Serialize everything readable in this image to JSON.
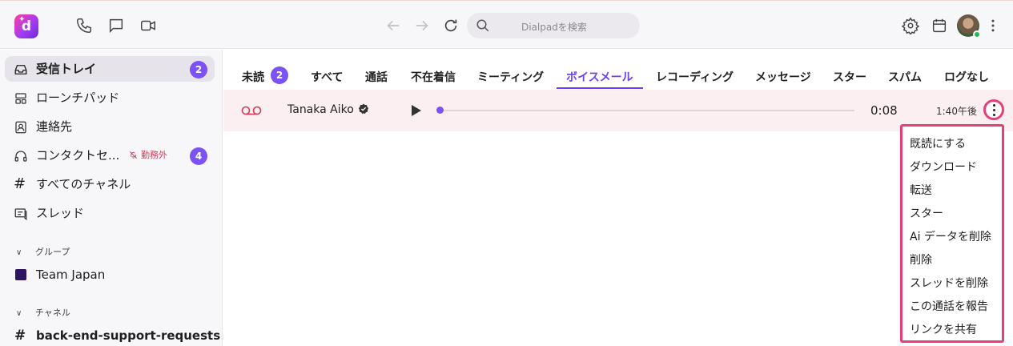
{
  "topbar": {
    "logo_letter": "d",
    "search_placeholder": "Dialpadを検索"
  },
  "sidebar": {
    "items": [
      {
        "label": "受信トレイ",
        "badge": "2",
        "icon": "inbox-icon"
      },
      {
        "label": "ローンチパッド",
        "icon": "launchpad-icon"
      },
      {
        "label": "連絡先",
        "icon": "contacts-icon"
      },
      {
        "label": "コンタクトセ...",
        "status": "勤務外",
        "badge": "4",
        "icon": "headset-icon"
      },
      {
        "label": "すべてのチャネル",
        "icon": "hash-icon"
      },
      {
        "label": "スレッド",
        "icon": "threads-icon"
      }
    ],
    "groups_header": "グループ",
    "groups": [
      {
        "label": "Team Japan",
        "color": "#2d1460"
      }
    ],
    "channels_header": "チャネル",
    "channels": [
      {
        "label": "back-end-support-requests"
      }
    ]
  },
  "tabs": {
    "items": [
      {
        "label": "未読",
        "badge": "2"
      },
      {
        "label": "すべて"
      },
      {
        "label": "通話"
      },
      {
        "label": "不在着信"
      },
      {
        "label": "ミーティング"
      },
      {
        "label": "ボイスメール",
        "active": true
      },
      {
        "label": "レコーディング"
      },
      {
        "label": "メッセージ"
      },
      {
        "label": "スター"
      },
      {
        "label": "スパム"
      },
      {
        "label": "ログなし"
      }
    ]
  },
  "voicemail_row": {
    "caller": "Tanaka Aiko",
    "duration": "0:08",
    "time": "1:40午後",
    "playback_progress": 0
  },
  "context_menu": {
    "items": [
      "既読にする",
      "ダウンロード",
      "転送",
      "スター",
      "Ai データを削除",
      "削除",
      "スレッドを削除",
      "この通話を報告",
      "リンクを共有"
    ]
  },
  "colors": {
    "accent": "#7c52f4",
    "active_tab": "#6d3ff0",
    "highlight_ring": "#e83e78",
    "row_background": "#fbeff1",
    "status_offduty": "#d23a5c"
  }
}
